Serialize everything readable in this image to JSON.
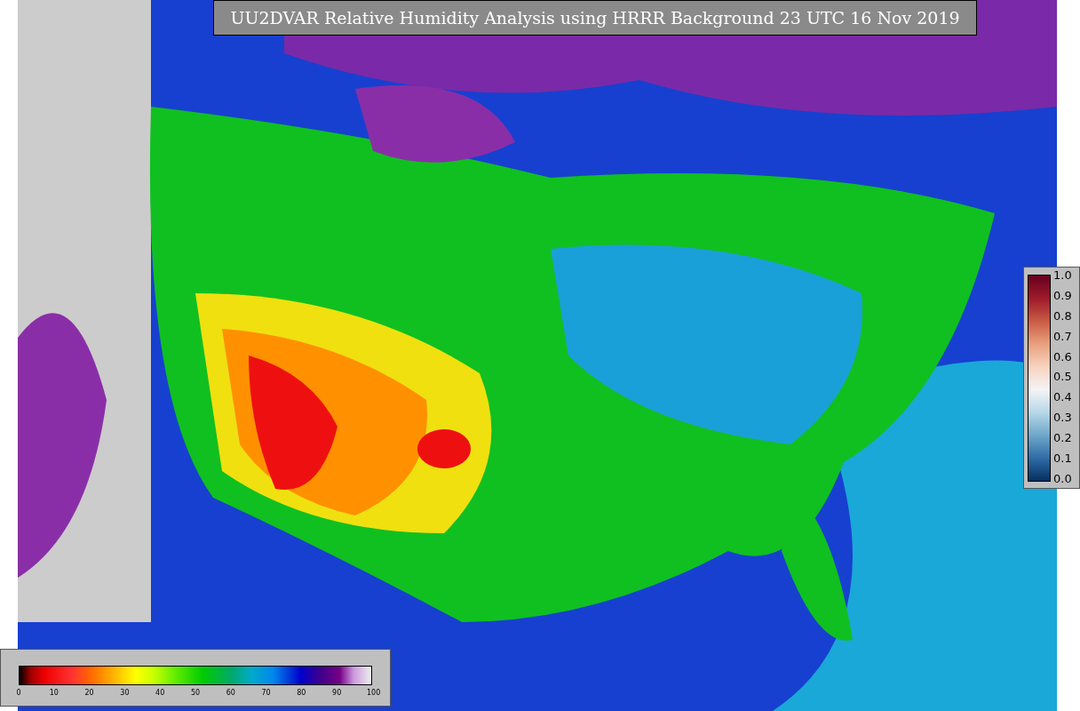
{
  "title": "UU2DVAR Relative Humidity Analysis using HRRR Background 23 UTC 16 Nov 2019",
  "fraction_colorbar": {
    "ticks": [
      "1.0",
      "0.9",
      "0.8",
      "0.7",
      "0.6",
      "0.5",
      "0.4",
      "0.3",
      "0.2",
      "0.1",
      "0.0"
    ]
  },
  "percent_colorbar": {
    "ticks": [
      "0",
      "10",
      "20",
      "30",
      "40",
      "50",
      "60",
      "70",
      "80",
      "90",
      "100"
    ]
  }
}
